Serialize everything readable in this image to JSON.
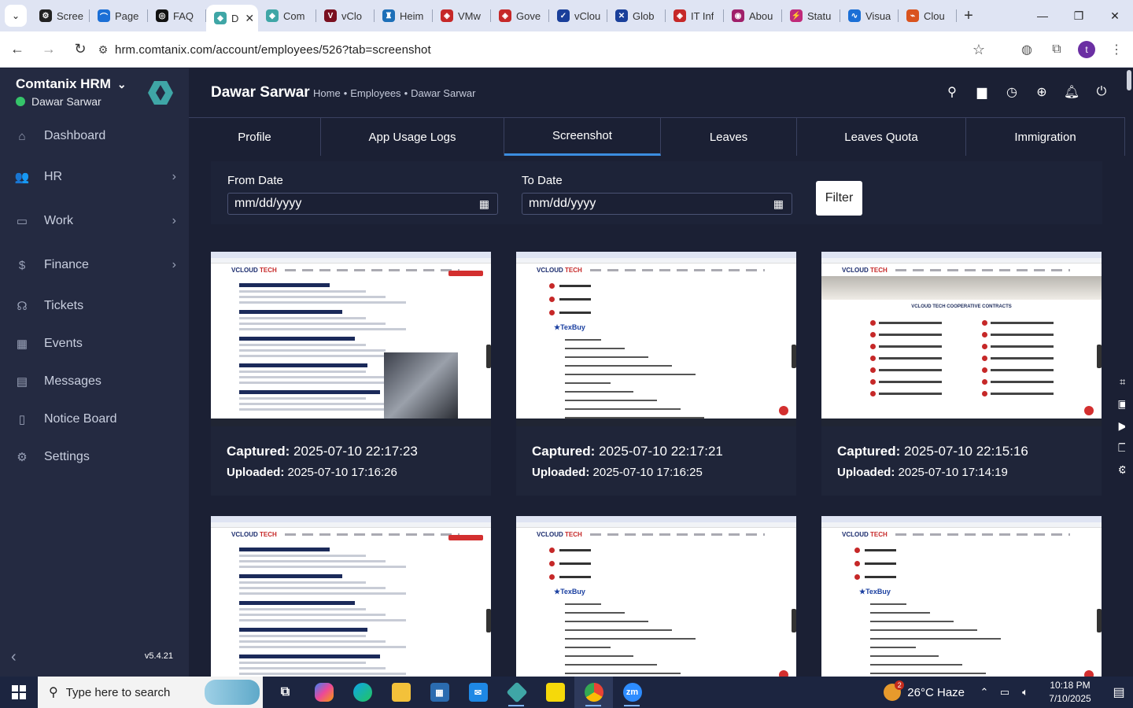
{
  "browser": {
    "tabs": [
      {
        "title": "Scree",
        "color": "#222222",
        "glyph": "⚙"
      },
      {
        "title": "Page",
        "color": "#1b6fd6",
        "glyph": "⌒"
      },
      {
        "title": "FAQ",
        "color": "#111111",
        "glyph": "◎"
      },
      {
        "title": "D",
        "color": "#3fa6a6",
        "glyph": "◆",
        "active": true
      },
      {
        "title": "Com",
        "color": "#3fa6a6",
        "glyph": "◆"
      },
      {
        "title": "vClo",
        "color": "#7a1020",
        "glyph": "V"
      },
      {
        "title": "Heim",
        "color": "#1d6fb8",
        "glyph": "♜"
      },
      {
        "title": "VMw",
        "color": "#c62828",
        "glyph": "◈"
      },
      {
        "title": "Gove",
        "color": "#c62828",
        "glyph": "◈"
      },
      {
        "title": "vClou",
        "color": "#1a3f9a",
        "glyph": "✓"
      },
      {
        "title": "Glob",
        "color": "#1a3f9a",
        "glyph": "✕"
      },
      {
        "title": "IT Inf",
        "color": "#c62828",
        "glyph": "◈"
      },
      {
        "title": "Abou",
        "color": "#a0206a",
        "glyph": "◉"
      },
      {
        "title": "Statu",
        "color": "#c02a7a",
        "glyph": "⚡"
      },
      {
        "title": "Visua",
        "color": "#1b6fd6",
        "glyph": "∿"
      },
      {
        "title": "Clou",
        "color": "#d9531e",
        "glyph": "⌁"
      }
    ],
    "url": "hrm.comtanix.com/account/employees/526?tab=screenshot",
    "profile_initial": "t"
  },
  "sidebar": {
    "brand": "Comtanix HRM",
    "user": "Dawar Sarwar",
    "items": [
      {
        "label": "Dashboard",
        "icon": "home-icon",
        "glyph": "⌂",
        "arrow": false
      },
      {
        "label": "HR",
        "icon": "users-icon",
        "glyph": "👥",
        "arrow": true
      },
      {
        "label": "Work",
        "icon": "briefcase-icon",
        "glyph": "▭",
        "arrow": true
      },
      {
        "label": "Finance",
        "icon": "dollar-icon",
        "glyph": "$",
        "arrow": true
      },
      {
        "label": "Tickets",
        "icon": "headset-icon",
        "glyph": "☊",
        "arrow": false
      },
      {
        "label": "Events",
        "icon": "calendar-icon",
        "glyph": "▦",
        "arrow": false
      },
      {
        "label": "Messages",
        "icon": "message-icon",
        "glyph": "▤",
        "arrow": false
      },
      {
        "label": "Notice Board",
        "icon": "clipboard-icon",
        "glyph": "▯",
        "arrow": false
      },
      {
        "label": "Settings",
        "icon": "gear-icon",
        "glyph": "⚙",
        "arrow": false
      }
    ],
    "version": "v5.4.21"
  },
  "header": {
    "title": "Dawar Sarwar",
    "breadcrumb": [
      "Home",
      "•",
      "Employees",
      "•",
      "Dawar Sarwar"
    ]
  },
  "tabs": [
    {
      "label": "Profile",
      "active": false
    },
    {
      "label": "App Usage Logs",
      "active": false
    },
    {
      "label": "Screenshot",
      "active": true
    },
    {
      "label": "Leaves",
      "active": false
    },
    {
      "label": "Leaves Quota",
      "active": false
    },
    {
      "label": "Immigration",
      "active": false
    }
  ],
  "filter": {
    "from_label": "From Date",
    "to_label": "To Date",
    "from_value": "mm/dd/yyyy",
    "to_value": "mm/dd/yyyy",
    "button": "Filter"
  },
  "screenshots": [
    {
      "kind": "article",
      "captured_label": "Captured:",
      "captured": "2025-07-10 22:17:23",
      "uploaded_label": "Uploaded:",
      "uploaded": "2025-07-10 17:16:26"
    },
    {
      "kind": "texbuy",
      "captured_label": "Captured:",
      "captured": "2025-07-10 22:17:21",
      "uploaded_label": "Uploaded:",
      "uploaded": "2025-07-10 17:16:25"
    },
    {
      "kind": "contracts",
      "captured_label": "Captured:",
      "captured": "2025-07-10 22:15:16",
      "uploaded_label": "Uploaded:",
      "uploaded": "2025-07-10 17:14:19"
    },
    {
      "kind": "article2"
    },
    {
      "kind": "texbuy"
    },
    {
      "kind": "texbuy"
    }
  ],
  "taskbar": {
    "search_placeholder": "Type here to search",
    "weather": "26°C  Haze",
    "weather_badge": "2",
    "time": "10:18 PM",
    "date": "7/10/2025"
  },
  "colors": {
    "sidebar_bg": "#242a41",
    "content_bg": "#1b2034",
    "active_tab_underline": "#3b8de0",
    "online": "#35c46a"
  }
}
